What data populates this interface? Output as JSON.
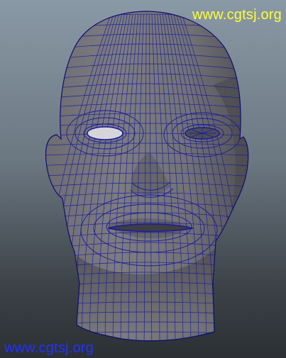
{
  "viewport": {
    "subject": "head-model-wireframe-on-shaded",
    "colors": {
      "background_top": "#8a99a6",
      "background_bottom": "#2c3034",
      "mesh_fill": "#75757a",
      "mesh_shade": "#4e4e53",
      "wireframe": "#1a1a9a",
      "watermark_top": "#ffff33",
      "watermark_bottom": "#2233ff"
    }
  },
  "watermarks": {
    "top": "www.cgtsj.org",
    "bottom": "www.cgtsj.org"
  }
}
